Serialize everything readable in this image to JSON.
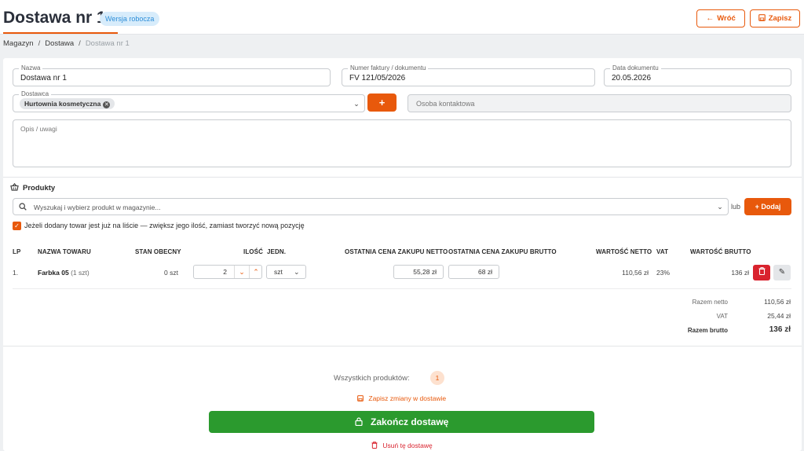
{
  "header": {
    "title": "Dostawa nr 1",
    "badge": "Wersja robocza",
    "back_label": "Wróć",
    "save_label": "Zapisz"
  },
  "breadcrumb": [
    "Magazyn",
    "Dostawa",
    "Dostawa nr 1"
  ],
  "form": {
    "name_label": "Nazwa",
    "name_value": "Dostawa nr 1",
    "invoice_label": "Numer faktury / dokumentu",
    "invoice_value": "FV 121/05/2026",
    "date_label": "Data dokumentu",
    "date_value": "20.05.2026",
    "supplier_label": "Dostawca",
    "supplier_chip": "Hurtownia kosmetyczna",
    "add_supplier_label": "+",
    "contact_placeholder": "Osoba kontaktowa",
    "notes_placeholder": "Opis / uwagi"
  },
  "products": {
    "section_title": "Produkty",
    "search_placeholder": "Wyszukaj i wybierz produkt w magazynie...",
    "or_label": "lub",
    "add_label": "+ Dodaj",
    "merge_checkbox_label": "Jeżeli dodany towar jest już na liście — zwiększ jego ilość, zamiast tworzyć nową pozycję",
    "columns": [
      "LP",
      "NAZWA TOWARU",
      "STAN OBECNY",
      "ILOŚĆ",
      "JEDN.",
      "OSTATNIA CENA ZAKUPU NETTO",
      "OSTATNIA CENA ZAKUPU BRUTTO",
      "WARTOŚĆ NETTO",
      "VAT",
      "WARTOŚĆ BRUTTO"
    ],
    "rows": [
      {
        "lp": "1.",
        "name": "Farbka 05",
        "pack": "(1 szt)",
        "stock": "0 szt",
        "qty": "2",
        "unit": "szt",
        "net_price": "55,28 zł",
        "gross_price": "68 zł",
        "net_value": "110,56 zł",
        "vat": "23%",
        "gross_value": "136 zł"
      }
    ]
  },
  "summary": {
    "net_label": "Razem netto",
    "net_value": "110,56 zł",
    "vat_label": "VAT",
    "vat_value": "25,44 zł",
    "gross_label": "Razem brutto",
    "gross_value": "136 zł"
  },
  "footer": {
    "count_label": "Wszystkich produktów:",
    "count_value": "1",
    "save_changes_label": "Zapisz zmiany w dostawie",
    "finish_label": "Zakończ dostawę",
    "delete_label": "Usuń tę dostawę"
  },
  "colors": {
    "accent": "#e8590c",
    "success": "#2b9a2e",
    "danger": "#d9232e",
    "badge_bg": "#d7ecfb"
  }
}
